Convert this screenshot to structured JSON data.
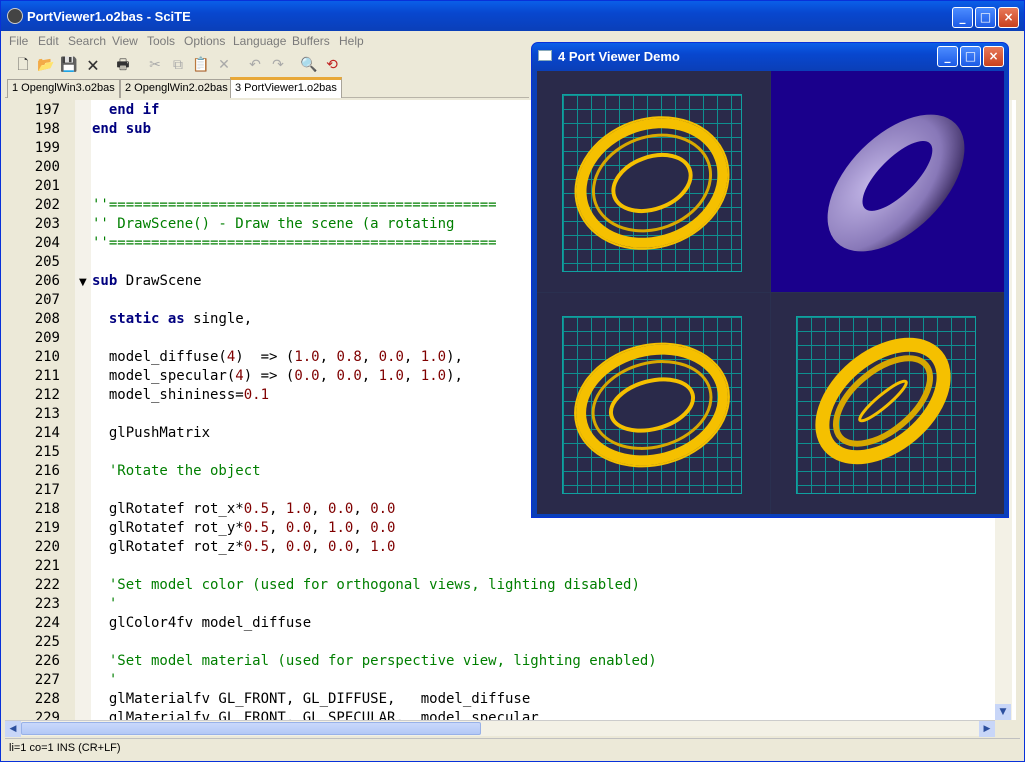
{
  "window": {
    "title": "PortViewer1.o2bas - SciTE"
  },
  "menu": [
    "File",
    "Edit",
    "Search",
    "View",
    "Tools",
    "Options",
    "Language",
    "Buffers",
    "Help"
  ],
  "tabs": [
    "1 OpenglWin3.o2bas",
    "2 OpenglWin2.o2bas",
    "3 PortViewer1.o2bas"
  ],
  "active_tab": 2,
  "lines": [
    {
      "n": "197",
      "code": "  end if"
    },
    {
      "n": "198",
      "code": "end sub"
    },
    {
      "n": "199",
      "code": ""
    },
    {
      "n": "200",
      "code": ""
    },
    {
      "n": "201",
      "code": ""
    },
    {
      "n": "202",
      "code": "''=============================================="
    },
    {
      "n": "203",
      "code": "'' DrawScene() - Draw the scene (a rotating"
    },
    {
      "n": "204",
      "code": "''=============================================="
    },
    {
      "n": "205",
      "code": ""
    },
    {
      "n": "206",
      "code": "sub DrawScene"
    },
    {
      "n": "207",
      "code": ""
    },
    {
      "n": "208",
      "code": "  static as single,"
    },
    {
      "n": "209",
      "code": ""
    },
    {
      "n": "210",
      "code": "  model_diffuse(4)  => (1.0, 0.8, 0.0, 1.0),"
    },
    {
      "n": "211",
      "code": "  model_specular(4) => (0.0, 0.0, 1.0, 1.0),"
    },
    {
      "n": "212",
      "code": "  model_shininess=0.1"
    },
    {
      "n": "213",
      "code": ""
    },
    {
      "n": "214",
      "code": "  glPushMatrix"
    },
    {
      "n": "215",
      "code": ""
    },
    {
      "n": "216",
      "code": "  'Rotate the object"
    },
    {
      "n": "217",
      "code": ""
    },
    {
      "n": "218",
      "code": "  glRotatef rot_x*0.5, 1.0, 0.0, 0.0"
    },
    {
      "n": "219",
      "code": "  glRotatef rot_y*0.5, 0.0, 1.0, 0.0"
    },
    {
      "n": "220",
      "code": "  glRotatef rot_z*0.5, 0.0, 0.0, 1.0"
    },
    {
      "n": "221",
      "code": ""
    },
    {
      "n": "222",
      "code": "  'Set model color (used for orthogonal views, lighting disabled)"
    },
    {
      "n": "223",
      "code": "  '"
    },
    {
      "n": "224",
      "code": "  glColor4fv model_diffuse"
    },
    {
      "n": "225",
      "code": ""
    },
    {
      "n": "226",
      "code": "  'Set model material (used for perspective view, lighting enabled)"
    },
    {
      "n": "227",
      "code": "  '"
    },
    {
      "n": "228",
      "code": "  glMaterialfv GL_FRONT, GL_DIFFUSE,   model_diffuse"
    },
    {
      "n": "229",
      "code": "  glMaterialfv GL_FRONT, GL_SPECULAR,  model_specular"
    }
  ],
  "status": "li=1 co=1 INS (CR+LF)",
  "popup": {
    "title": "4 Port Viewer Demo"
  },
  "colors": {
    "wire": "#f5c000",
    "torus": "#9a8cc8",
    "grid": "#0e8f8f",
    "persp_bg": "#1a008c"
  }
}
